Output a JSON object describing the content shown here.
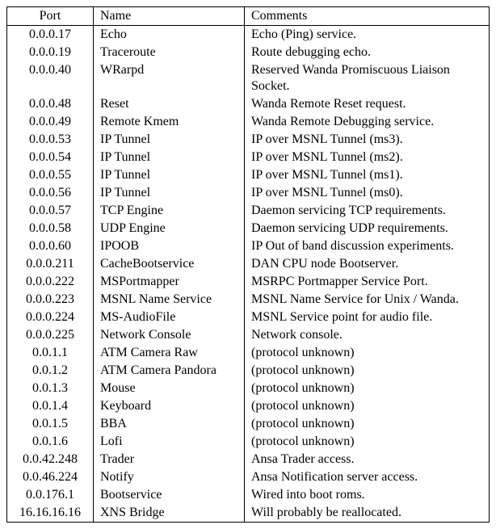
{
  "table": {
    "headers": [
      "Port",
      "Name",
      "Comments"
    ],
    "rows": [
      {
        "port": "0.0.0.17",
        "name": "Echo",
        "comment": "Echo (Ping) service."
      },
      {
        "port": "0.0.0.19",
        "name": "Traceroute",
        "comment": "Route debugging echo."
      },
      {
        "port": "0.0.0.40",
        "name": "WRarpd",
        "comment": "Reserved Wanda Promiscuous Liaison Socket."
      },
      {
        "port": "0.0.0.48",
        "name": "Reset",
        "comment": "Wanda Remote Reset request."
      },
      {
        "port": "0.0.0.49",
        "name": "Remote Kmem",
        "comment": "Wanda Remote Debugging service."
      },
      {
        "port": "0.0.0.53",
        "name": "IP Tunnel",
        "comment": "IP over MSNL Tunnel (ms3)."
      },
      {
        "port": "0.0.0.54",
        "name": "IP Tunnel",
        "comment": "IP over MSNL Tunnel (ms2)."
      },
      {
        "port": "0.0.0.55",
        "name": "IP Tunnel",
        "comment": "IP over MSNL Tunnel (ms1)."
      },
      {
        "port": "0.0.0.56",
        "name": "IP Tunnel",
        "comment": "IP over MSNL Tunnel (ms0)."
      },
      {
        "port": "0.0.0.57",
        "name": "TCP Engine",
        "comment": "Daemon servicing TCP requirements."
      },
      {
        "port": "0.0.0.58",
        "name": "UDP Engine",
        "comment": "Daemon servicing UDP requirements."
      },
      {
        "port": "0.0.0.60",
        "name": "IPOOB",
        "comment": "IP Out of band discussion experiments."
      },
      {
        "port": "0.0.0.211",
        "name": "CacheBootservice",
        "comment": "DAN CPU node Bootserver."
      },
      {
        "port": "0.0.0.222",
        "name": "MSPortmapper",
        "comment": "MSRPC Portmapper Service Port."
      },
      {
        "port": "0.0.0.223",
        "name": "MSNL Name Service",
        "comment": "MSNL Name Service for Unix / Wanda."
      },
      {
        "port": "0.0.0.224",
        "name": "MS-AudioFile",
        "comment": "MSNL Service point for audio file."
      },
      {
        "port": "0.0.0.225",
        "name": "Network Console",
        "comment": "Network console."
      },
      {
        "port": "0.0.1.1",
        "name": "ATM Camera Raw",
        "comment": "(protocol unknown)"
      },
      {
        "port": "0.0.1.2",
        "name": "ATM Camera Pandora",
        "comment": "(protocol unknown)"
      },
      {
        "port": "0.0.1.3",
        "name": "Mouse",
        "comment": "(protocol unknown)"
      },
      {
        "port": "0.0.1.4",
        "name": "Keyboard",
        "comment": "(protocol unknown)"
      },
      {
        "port": "0.0.1.5",
        "name": "BBA",
        "comment": "(protocol unknown)"
      },
      {
        "port": "0.0.1.6",
        "name": "Lofi",
        "comment": "(protocol unknown)"
      },
      {
        "port": "0.0.42.248",
        "name": "Trader",
        "comment": "Ansa Trader access."
      },
      {
        "port": "0.0.46.224",
        "name": "Notify",
        "comment": "Ansa Notification server access."
      },
      {
        "port": "0.0.176.1",
        "name": "Bootservice",
        "comment": "Wired into boot roms."
      },
      {
        "port": "16.16.16.16",
        "name": "XNS Bridge",
        "comment": "Will probably be reallocated."
      }
    ]
  }
}
